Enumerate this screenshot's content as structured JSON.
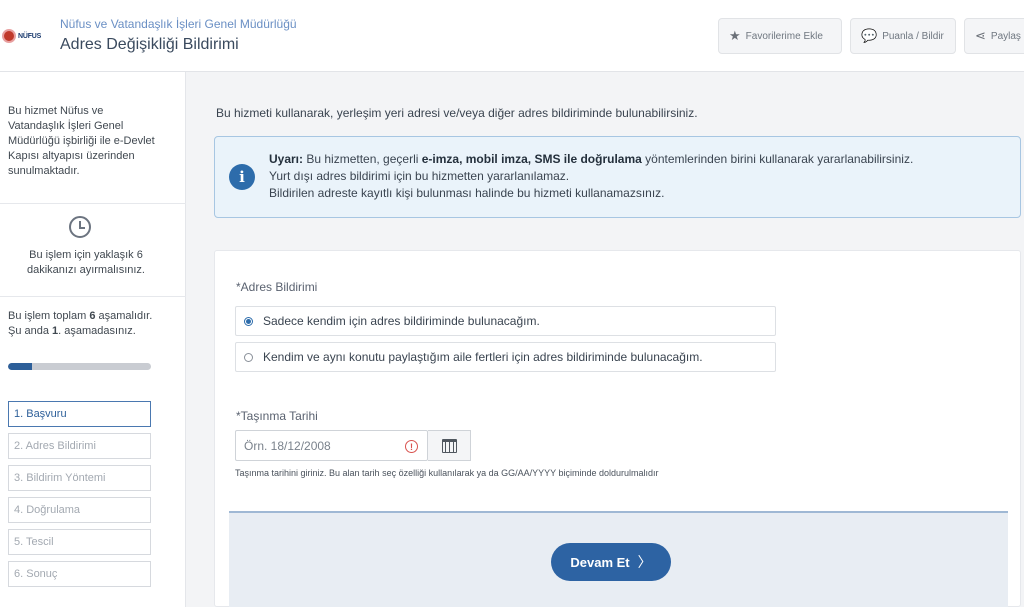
{
  "header": {
    "logo_text": "NÜFUS",
    "org": "Nüfus ve Vatandaşlık İşleri Genel Müdürlüğü",
    "title": "Adres Değişikliği Bildirimi",
    "buttons": [
      {
        "label": "Favorilerime Ekle",
        "icon": "star-icon"
      },
      {
        "label": "Puanla / Bildir",
        "icon": "comment-icon"
      },
      {
        "label": "Paylaş",
        "icon": "share-icon"
      }
    ]
  },
  "sidebar": {
    "info": "Bu hizmet Nüfus ve Vatandaşlık İşleri Genel Müdürlüğü işbirliği ile e-Devlet Kapısı altyapısı üzerinden sunulmaktadır.",
    "time": "Bu işlem için yaklaşık 6 dakikanızı ayırmalısınız.",
    "steps_pre": "Bu işlem toplam ",
    "steps_total": "6",
    "steps_mid": " aşamalıdır. Şu anda ",
    "steps_current": "1",
    "steps_post": ". aşamadasınız.",
    "progress": 0.17,
    "steps": [
      "1. Başvuru",
      "2. Adres Bildirimi",
      "3. Bildirim Yöntemi",
      "4. Doğrulama",
      "5. Tescil",
      "6. Sonuç"
    ]
  },
  "main": {
    "intro": "Bu hizmeti kullanarak, yerleşim yeri adresi ve/veya diğer adres bildiriminde bulunabilirsiniz.",
    "alert": {
      "label": "Uyarı:",
      "line1_a": " Bu hizmetten, geçerli ",
      "line1_b": "e-imza, mobil imza, SMS ile doğrulama",
      "line1_c": " yöntemlerinden birini kullanarak yararlanabilirsiniz.",
      "line2": "Yurt dışı adres bildirimi için bu hizmetten yararlanılamaz.",
      "line3": "Bildirilen adreste kayıtlı kişi bulunması halinde bu hizmeti kullanamazsınız."
    },
    "adres_label": "*Adres Bildirimi",
    "options": [
      "Sadece kendim için adres bildiriminde bulunacağım.",
      "Kendim ve aynı konutu paylaştığım aile fertleri için adres bildiriminde bulunacağım."
    ],
    "selected_option": 0,
    "tasinma_label": "*Taşınma Tarihi",
    "date_placeholder": "Örn. 18/12/2008",
    "hint": "Taşınma tarihini giriniz. Bu alan tarih seç özelliği kullanılarak ya da GG/AA/YYYY biçiminde doldurulmalıdır",
    "continue_label": "Devam Et",
    "continue_icon": "chevron-right-icon"
  }
}
